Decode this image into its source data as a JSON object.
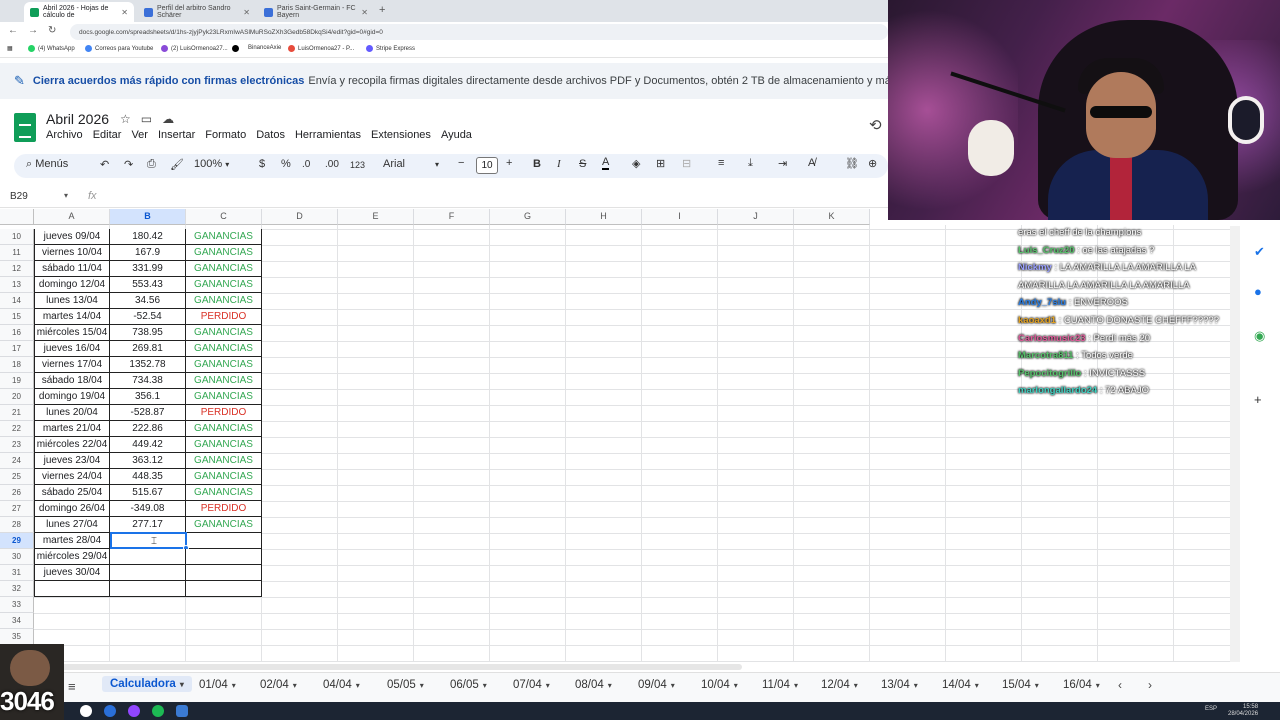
{
  "browser": {
    "tabs": [
      {
        "label": "Abril 2026 - Hojas de cálculo de",
        "active": true,
        "color": "#0f9d58"
      },
      {
        "label": "Perfil del arbitro Sandro Schärer",
        "active": false,
        "color": "#3b6fd8"
      },
      {
        "label": "Paris Saint-Germain - FC Bayern",
        "active": false,
        "color": "#3b6fd8"
      }
    ],
    "url": "docs.google.com/spreadsheets/d/1hs-zjyjPyk23LRxmIwASlMuRSoZXh3Gedb58DkqSi4/edit?gid=0#gid=0",
    "bookmarks": [
      {
        "label": "(4) WhatsApp",
        "color": "#25d366"
      },
      {
        "label": "Correos para Youtube",
        "color": "#4285f4"
      },
      {
        "label": "(2) LuisOrmenoa27...",
        "color": "#8a4bd8"
      },
      {
        "label": "",
        "color": "#000000"
      },
      {
        "label": "BinanceAxie",
        "color": "#f0b90b"
      },
      {
        "label": "LuisOrmenoa27 - P...",
        "color": "#e74c3c"
      },
      {
        "label": "Stripe Express",
        "color": "#635bff"
      }
    ]
  },
  "banner": {
    "bold": "Cierra acuerdos más rápido con firmas electrónicas",
    "rest": "Envía y recopila firmas digitales directamente desde archivos PDF y Documentos, obtén 2 TB de almacenamiento y más."
  },
  "doc": {
    "title": "Abril 2026",
    "menu": [
      "Archivo",
      "Editar",
      "Ver",
      "Insertar",
      "Formato",
      "Datos",
      "Herramientas",
      "Extensiones",
      "Ayuda"
    ]
  },
  "toolbar": {
    "search": "Menús",
    "zoom": "100%",
    "currency": "$",
    "percent": "%",
    "dec_less": ".0",
    "dec_more": ".00",
    "numfmt": "123",
    "font": "Arial",
    "font_size": "10"
  },
  "formula_bar": {
    "cell": "B29",
    "fx": "fx"
  },
  "grid": {
    "columns": [
      "A",
      "B",
      "C",
      "D",
      "E",
      "F",
      "G",
      "H",
      "I",
      "J",
      "K"
    ],
    "selected_column": "B",
    "selected_row": 29,
    "rows": [
      {
        "n": 10,
        "a": "jueves 09/04",
        "b": "180.42",
        "c": "GANANCIAS",
        "status": "win"
      },
      {
        "n": 11,
        "a": "viernes 10/04",
        "b": "167.9",
        "c": "GANANCIAS",
        "status": "win"
      },
      {
        "n": 12,
        "a": "sábado 11/04",
        "b": "331.99",
        "c": "GANANCIAS",
        "status": "win"
      },
      {
        "n": 13,
        "a": "domingo 12/04",
        "b": "553.43",
        "c": "GANANCIAS",
        "status": "win"
      },
      {
        "n": 14,
        "a": "lunes 13/04",
        "b": "34.56",
        "c": "GANANCIAS",
        "status": "win"
      },
      {
        "n": 15,
        "a": "martes 14/04",
        "b": "-52.54",
        "c": "PERDIDO",
        "status": "loss"
      },
      {
        "n": 16,
        "a": "miércoles 15/04",
        "b": "738.95",
        "c": "GANANCIAS",
        "status": "win"
      },
      {
        "n": 17,
        "a": "jueves 16/04",
        "b": "269.81",
        "c": "GANANCIAS",
        "status": "win"
      },
      {
        "n": 18,
        "a": "viernes 17/04",
        "b": "1352.78",
        "c": "GANANCIAS",
        "status": "win"
      },
      {
        "n": 19,
        "a": "sábado 18/04",
        "b": "734.38",
        "c": "GANANCIAS",
        "status": "win"
      },
      {
        "n": 20,
        "a": "domingo 19/04",
        "b": "356.1",
        "c": "GANANCIAS",
        "status": "win"
      },
      {
        "n": 21,
        "a": "lunes 20/04",
        "b": "-528.87",
        "c": "PERDIDO",
        "status": "loss"
      },
      {
        "n": 22,
        "a": "martes 21/04",
        "b": "222.86",
        "c": "GANANCIAS",
        "status": "win"
      },
      {
        "n": 23,
        "a": "miércoles 22/04",
        "b": "449.42",
        "c": "GANANCIAS",
        "status": "win"
      },
      {
        "n": 24,
        "a": "jueves 23/04",
        "b": "363.12",
        "c": "GANANCIAS",
        "status": "win"
      },
      {
        "n": 25,
        "a": "viernes 24/04",
        "b": "448.35",
        "c": "GANANCIAS",
        "status": "win"
      },
      {
        "n": 26,
        "a": "sábado 25/04",
        "b": "515.67",
        "c": "GANANCIAS",
        "status": "win"
      },
      {
        "n": 27,
        "a": "domingo 26/04",
        "b": "-349.08",
        "c": "PERDIDO",
        "status": "loss"
      },
      {
        "n": 28,
        "a": "lunes 27/04",
        "b": "277.17",
        "c": "GANANCIAS",
        "status": "win"
      },
      {
        "n": 29,
        "a": "martes 28/04",
        "b": "",
        "c": "",
        "status": ""
      },
      {
        "n": 30,
        "a": "miércoles 29/04",
        "b": "",
        "c": "",
        "status": ""
      },
      {
        "n": 31,
        "a": "jueves 30/04",
        "b": "",
        "c": "",
        "status": ""
      },
      {
        "n": 32,
        "a": "",
        "b": "",
        "c": "",
        "status": ""
      },
      {
        "n": 33,
        "a": "",
        "b": "",
        "c": "",
        "status": "empty"
      },
      {
        "n": 34,
        "a": "",
        "b": "",
        "c": "",
        "status": "empty"
      },
      {
        "n": 35,
        "a": "",
        "b": "",
        "c": "",
        "status": "empty"
      },
      {
        "n": 36,
        "a": "",
        "b": "",
        "c": "",
        "status": "empty"
      }
    ]
  },
  "sheet_tabs": [
    "Calculadora",
    "01/04",
    "02/04",
    "04/04",
    "05/05",
    "06/05",
    "07/04",
    "08/04",
    "09/04",
    "10/04",
    "11/04",
    "12/04",
    "13/04",
    "14/04",
    "15/04",
    "16/04"
  ],
  "active_sheet": "Calculadora",
  "chat": [
    {
      "user": "",
      "text": "eras el cheff de la champions",
      "color": "#ffffff"
    },
    {
      "user": "Luis_Cruz20",
      "text": ": oe las atajadas ?",
      "color": "#57c26b"
    },
    {
      "user": "Nickmy",
      "text": ": LA AMARILLA LA AMARILLA LA AMARILLA LA AMARILLA LA AMARILLA",
      "color": "#9aa0ff"
    },
    {
      "user": "Andy_7slu",
      "text": ": ENVEROOS",
      "color": "#2a7de1"
    },
    {
      "user": "kaoaxd1",
      "text": ": CUANTO DONASTE CHEFFF?????",
      "color": "#e0a020"
    },
    {
      "user": "Carlosmusic23",
      "text": ": Perdí más 20",
      "color": "#e05a9a"
    },
    {
      "user": "Marcotra811",
      "text": ": Todos verde",
      "color": "#57c26b"
    },
    {
      "user": "Pepocitogrillo",
      "text": ": INVICTASSS",
      "color": "#57c26b"
    },
    {
      "user": "marlongallardo24",
      "text": ": 72 ABAJO",
      "color": "#3fd0c0"
    }
  ],
  "overlay_number": "3046",
  "tray": {
    "lang": "ESP",
    "time": "15:58",
    "date": "28/04/2026"
  },
  "colors": {
    "gain": "#34a853",
    "loss": "#d93025",
    "selection": "#1a73e8"
  }
}
